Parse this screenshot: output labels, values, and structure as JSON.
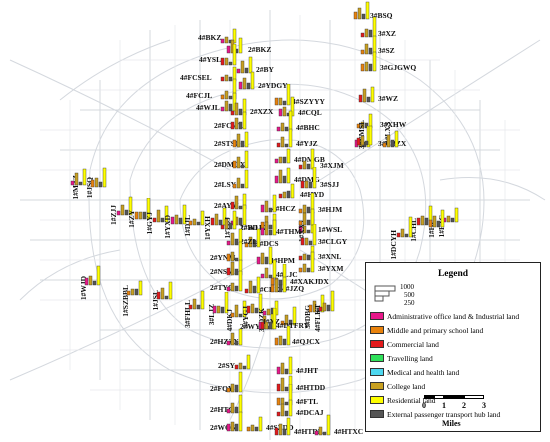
{
  "stations": [
    {
      "name": "4#BKZ",
      "vertical": false
    },
    {
      "name": "3#BSQ",
      "vertical": false
    },
    {
      "name": "3#XZ",
      "vertical": false
    },
    {
      "name": "2#BKZ",
      "vertical": false
    },
    {
      "name": "3#SZ",
      "vertical": false
    },
    {
      "name": "4#YSL",
      "vertical": false
    },
    {
      "name": "2#BY",
      "vertical": false
    },
    {
      "name": "3#GJGWQ",
      "vertical": false
    },
    {
      "name": "4#FCSEL",
      "vertical": false
    },
    {
      "name": "2#YDGY",
      "vertical": false
    },
    {
      "name": "4#FCJL",
      "vertical": false
    },
    {
      "name": "3#WZ",
      "vertical": false
    },
    {
      "name": "4#WJL",
      "vertical": false
    },
    {
      "name": "4#SZYYY",
      "vertical": false
    },
    {
      "name": "2#XZX",
      "vertical": false
    },
    {
      "name": "4#CQL",
      "vertical": false
    },
    {
      "name": "3#XHW",
      "vertical": false
    },
    {
      "name": "2#FCWL",
      "vertical": false
    },
    {
      "name": "4#BHC",
      "vertical": false
    },
    {
      "name": "2#STSG",
      "vertical": false
    },
    {
      "name": "4#YJZ",
      "vertical": false
    },
    {
      "name": "3#CBZX",
      "vertical": false
    },
    {
      "name": "3#LXS",
      "vertical": true
    },
    {
      "name": "3#YMSL",
      "vertical": true
    },
    {
      "name": "4#DMGB",
      "vertical": false
    },
    {
      "name": "2#DMGX",
      "vertical": false
    },
    {
      "name": "3#XJM",
      "vertical": false
    },
    {
      "name": "4#DMG",
      "vertical": false
    },
    {
      "name": "2#LSY",
      "vertical": false
    },
    {
      "name": "3#SJJ",
      "vertical": false
    },
    {
      "name": "1#MZZ",
      "vertical": true
    },
    {
      "name": "1#JSQ",
      "vertical": true
    },
    {
      "name": "4#HYD",
      "vertical": false
    },
    {
      "name": "4#HCZ",
      "vertical": false
    },
    {
      "name": "3#HJM",
      "vertical": false
    },
    {
      "name": "2#AYM",
      "vertical": false
    },
    {
      "name": "1#ZJJ",
      "vertical": true
    },
    {
      "name": "1#ZY",
      "vertical": true
    },
    {
      "name": "1#GYJ",
      "vertical": true
    },
    {
      "name": "1#YXD",
      "vertical": true
    },
    {
      "name": "1#DJL",
      "vertical": true
    },
    {
      "name": "1#YXH",
      "vertical": true
    },
    {
      "name": "1#TDJ",
      "vertical": true
    },
    {
      "name": "2#WLK",
      "vertical": false
    },
    {
      "name": "1#BDJ",
      "vertical": false
    },
    {
      "name": "1#WSL",
      "vertical": false
    },
    {
      "name": "1#XXJ",
      "vertical": true
    },
    {
      "name": "1#CHL",
      "vertical": true
    },
    {
      "name": "1#FZC",
      "vertical": true
    },
    {
      "name": "1#HP",
      "vertical": true
    },
    {
      "name": "1#DCYH",
      "vertical": true
    },
    {
      "name": "4#THM",
      "vertical": false
    },
    {
      "name": "2#DCS",
      "vertical": false
    },
    {
      "name": "3#CLGY",
      "vertical": false
    },
    {
      "name": "2#ZL",
      "vertical": false
    },
    {
      "name": "2#YNM",
      "vertical": false
    },
    {
      "name": "3#XNL",
      "vertical": false
    },
    {
      "name": "4#HPM",
      "vertical": false
    },
    {
      "name": "3#YXM",
      "vertical": false
    },
    {
      "name": "2#NSM",
      "vertical": false
    },
    {
      "name": "4#LJC",
      "vertical": false
    },
    {
      "name": "4#XAKJDX",
      "vertical": false
    },
    {
      "name": "1#CDX",
      "vertical": false
    },
    {
      "name": "1#WJD",
      "vertical": true
    },
    {
      "name": "1#SZBBL",
      "vertical": true
    },
    {
      "name": "1#JSL",
      "vertical": true
    },
    {
      "name": "2#TYC",
      "vertical": false
    },
    {
      "name": "4#JZQ",
      "vertical": false
    },
    {
      "name": "3#FHLL",
      "vertical": true
    },
    {
      "name": "3#LJZ",
      "vertical": true
    },
    {
      "name": "4#DKJ",
      "vertical": true
    },
    {
      "name": "3#YGJ",
      "vertical": true
    },
    {
      "name": "3#QZK",
      "vertical": true
    },
    {
      "name": "3#DBG",
      "vertical": true
    },
    {
      "name": "4#FLKT",
      "vertical": true
    },
    {
      "name": "2#WYJ",
      "vertical": false
    },
    {
      "name": "4#XZ",
      "vertical": false
    },
    {
      "name": "4#DTFRY",
      "vertical": false
    },
    {
      "name": "2#HZZX",
      "vertical": false
    },
    {
      "name": "4#QJCX",
      "vertical": false
    },
    {
      "name": "2#SY",
      "vertical": false
    },
    {
      "name": "4#JHT",
      "vertical": false
    },
    {
      "name": "2#FQY",
      "vertical": false
    },
    {
      "name": "4#HTDD",
      "vertical": false
    },
    {
      "name": "2#HTC",
      "vertical": false
    },
    {
      "name": "4#FTL",
      "vertical": false
    },
    {
      "name": "4#DCAJ",
      "vertical": false
    },
    {
      "name": "2#WQN",
      "vertical": false
    },
    {
      "name": "4#SZDD",
      "vertical": false
    },
    {
      "name": "4#HTDL",
      "vertical": false
    },
    {
      "name": "4#HTXC",
      "vertical": false
    }
  ],
  "legend": {
    "title": "Legend",
    "sizes": [
      "1000",
      "500",
      "250"
    ],
    "items": [
      {
        "label": "Administrative office land & Industrial land",
        "color": "#e8178a"
      },
      {
        "label": "Middle and primary school land",
        "color": "#e8820c"
      },
      {
        "label": "Commercial land",
        "color": "#e31a1c"
      },
      {
        "label": "Travelling land",
        "color": "#2fe05a"
      },
      {
        "label": "Medical and health land",
        "color": "#4ed8f0"
      },
      {
        "label": "College land",
        "color": "#c8a020"
      },
      {
        "label": "Residential land",
        "color": "#ffff00"
      },
      {
        "label": "External passenger transport hub land",
        "color": "#555555"
      }
    ]
  },
  "scale_bar": {
    "ticks": [
      "0",
      "1",
      "2",
      "3"
    ],
    "unit": "Miles"
  }
}
